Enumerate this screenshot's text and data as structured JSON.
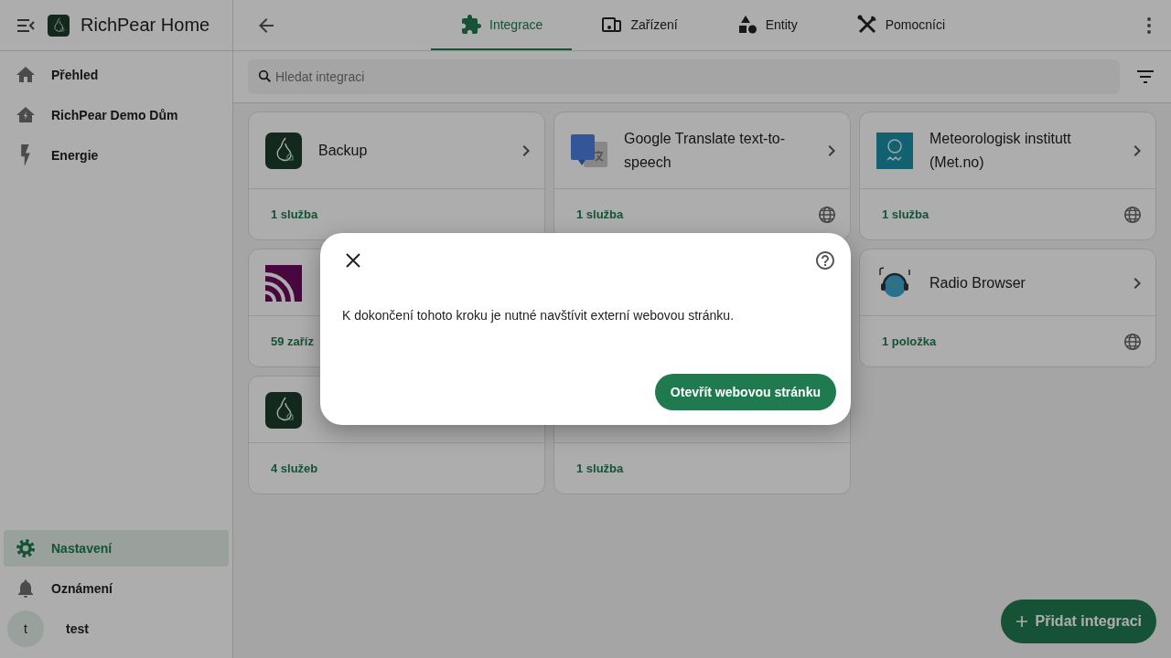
{
  "sidebar": {
    "title": "RichPear Home",
    "nav": [
      {
        "label": "Přehled",
        "selected": false
      },
      {
        "label": "RichPear Demo Dům",
        "selected": false
      },
      {
        "label": "Energie",
        "selected": false
      }
    ],
    "bottom": [
      {
        "label": "Nastavení",
        "selected": true
      },
      {
        "label": "Oznámení",
        "selected": false
      }
    ],
    "user": {
      "initial": "t",
      "name": "test"
    }
  },
  "tabs": [
    {
      "label": "Integrace",
      "selected": true
    },
    {
      "label": "Zařízení",
      "selected": false
    },
    {
      "label": "Entity",
      "selected": false
    },
    {
      "label": "Pomocníci",
      "selected": false
    }
  ],
  "search": {
    "placeholder": "Hledat integraci"
  },
  "cards": [
    {
      "kind": "integration",
      "title": "Backup",
      "footer": "1 služba",
      "web": false
    },
    {
      "kind": "integration",
      "title": "Google Translate text-to-speech",
      "footer": "1 služba",
      "web": true
    },
    {
      "kind": "integration",
      "title": "Meteorologisk institutt (Met.no)",
      "footer": "1 služba",
      "web": true
    },
    {
      "kind": "integration",
      "footer": "59 zaříz"
    },
    {
      "kind": "integration",
      "title": "Radio Browser",
      "footer": "1 položka",
      "web": true
    },
    {
      "kind": "integration",
      "footer": "4 služeb",
      "web": false
    },
    {
      "kind": "integration",
      "footer": "1 služba",
      "web": false
    }
  ],
  "fab": {
    "label": "Přidat integraci"
  },
  "dialog": {
    "message": "K dokončení tohoto kroku je nutné navštívit externí webovou stránku.",
    "button": "Otevřít webovou stránku"
  }
}
